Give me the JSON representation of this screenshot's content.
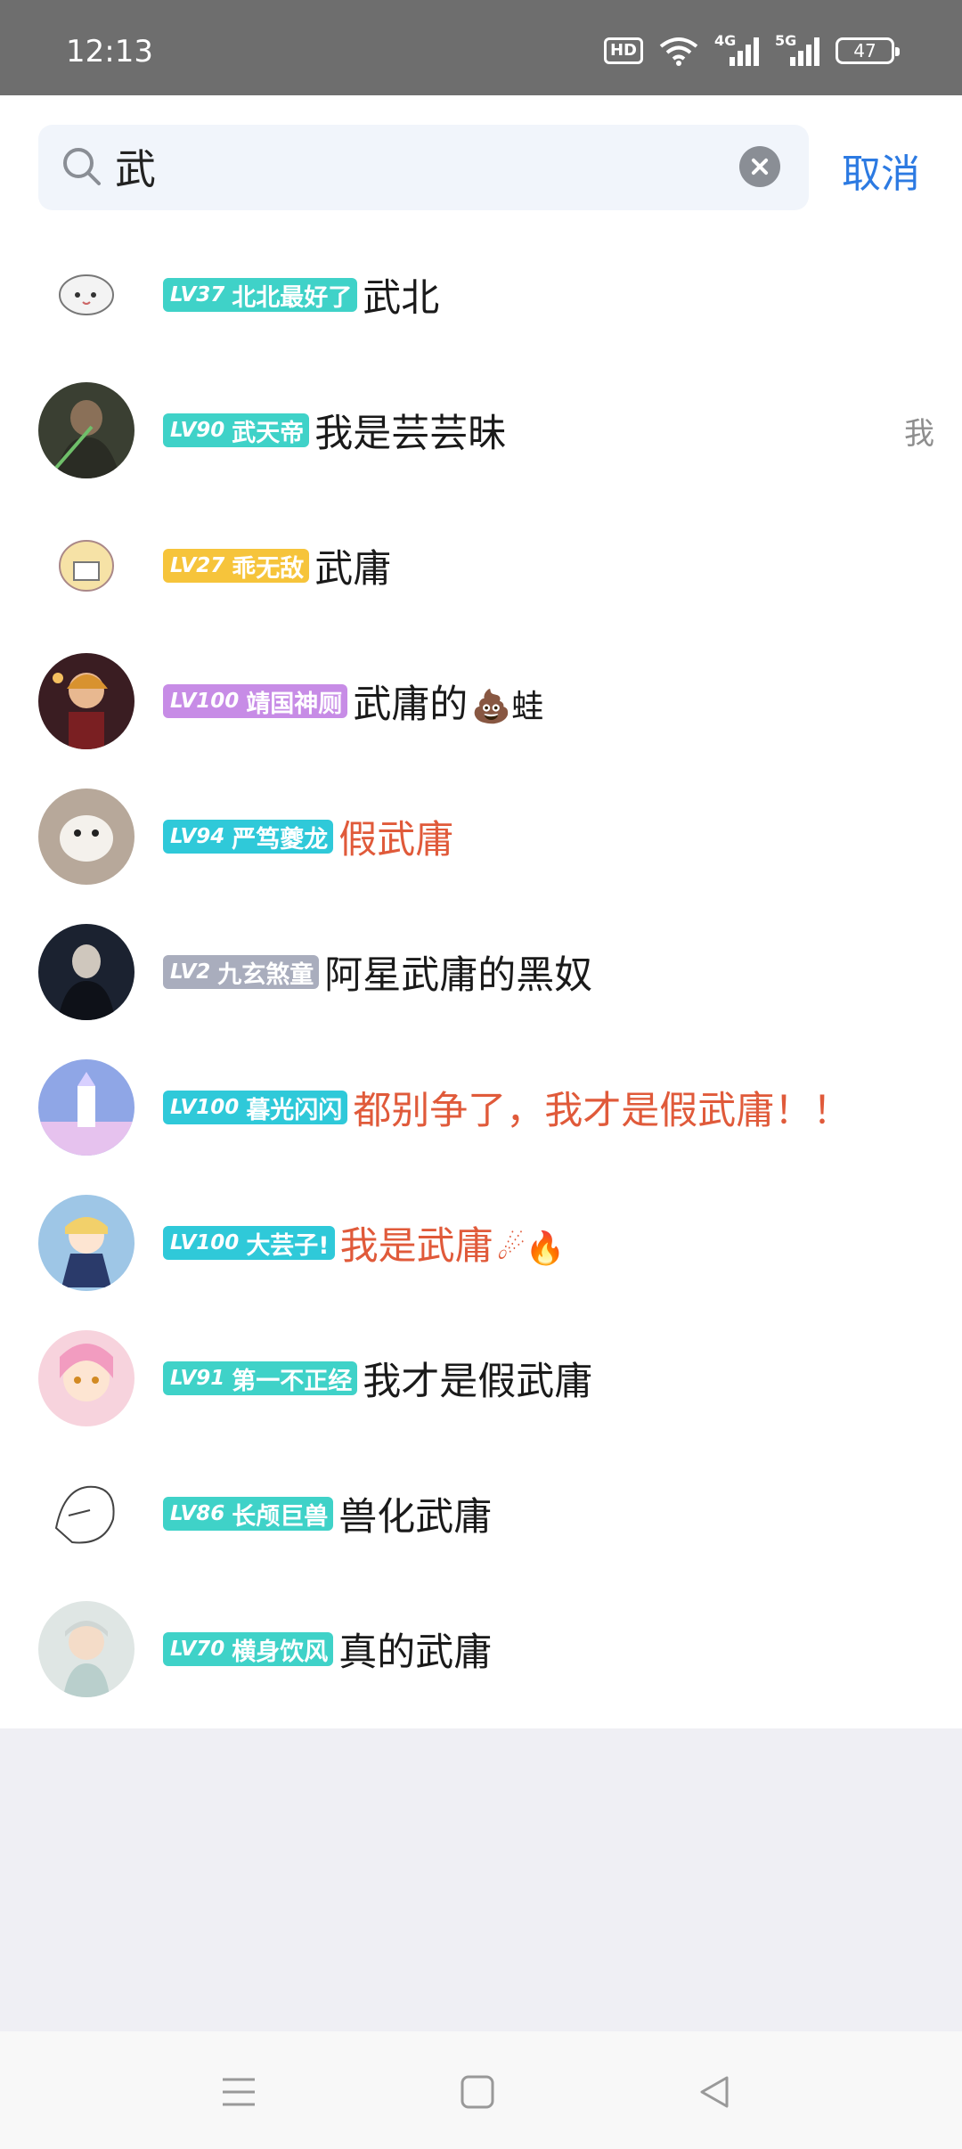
{
  "status_bar": {
    "time": "12:13",
    "hd_label": "HD",
    "net1_label": "4G",
    "net2_label": "5G",
    "battery": "47"
  },
  "search": {
    "query": "武",
    "cancel_label": "取消"
  },
  "results": [
    {
      "level": "LV37",
      "title": "北北最好了",
      "name": "武北",
      "badge_color": "#3fd2c8",
      "name_color": "normal",
      "emoji": "",
      "me_tag": ""
    },
    {
      "level": "LV90",
      "title": "武天帝",
      "name": "我是芸芸昧",
      "badge_color": "#3fd2c8",
      "name_color": "normal",
      "emoji": "",
      "me_tag": "我"
    },
    {
      "level": "LV27",
      "title": "乖无敌",
      "name": "武庸",
      "badge_color": "#f6c43b",
      "name_color": "normal",
      "emoji": "",
      "me_tag": ""
    },
    {
      "level": "LV100",
      "title": "靖国神厕",
      "name": "武庸的",
      "badge_color": "#c78ce6",
      "name_color": "normal",
      "emoji": "💩蛙",
      "me_tag": ""
    },
    {
      "level": "LV94",
      "title": "严笃夔龙",
      "name": "假武庸",
      "badge_color": "#2fc9d9",
      "name_color": "red",
      "emoji": "",
      "me_tag": ""
    },
    {
      "level": "LV2",
      "title": "九玄煞童",
      "name": "阿星武庸的黑奴",
      "badge_color": "#a9adbd",
      "name_color": "normal",
      "emoji": "",
      "me_tag": ""
    },
    {
      "level": "LV100",
      "title": "暮光闪闪",
      "name": "都别争了，我才是假武庸！！",
      "badge_color": "#2fc9d9",
      "name_color": "red",
      "emoji": "",
      "me_tag": ""
    },
    {
      "level": "LV100",
      "title": "大芸子!",
      "name": "我是武庸",
      "badge_color": "#2fc9d9",
      "name_color": "red",
      "emoji": "☄🔥",
      "me_tag": ""
    },
    {
      "level": "LV91",
      "title": "第一不正经",
      "name": "我才是假武庸",
      "badge_color": "#3fd2c8",
      "name_color": "normal",
      "emoji": "",
      "me_tag": ""
    },
    {
      "level": "LV86",
      "title": "长颅巨兽",
      "name": "兽化武庸",
      "badge_color": "#3fd2c8",
      "name_color": "normal",
      "emoji": "",
      "me_tag": ""
    },
    {
      "level": "LV70",
      "title": "横身饮风",
      "name": "真的武庸",
      "badge_color": "#3fd2c8",
      "name_color": "normal",
      "emoji": "",
      "me_tag": ""
    }
  ],
  "colors": {
    "accent": "#2c7ae2",
    "highlight_name": "#e05a3a"
  }
}
